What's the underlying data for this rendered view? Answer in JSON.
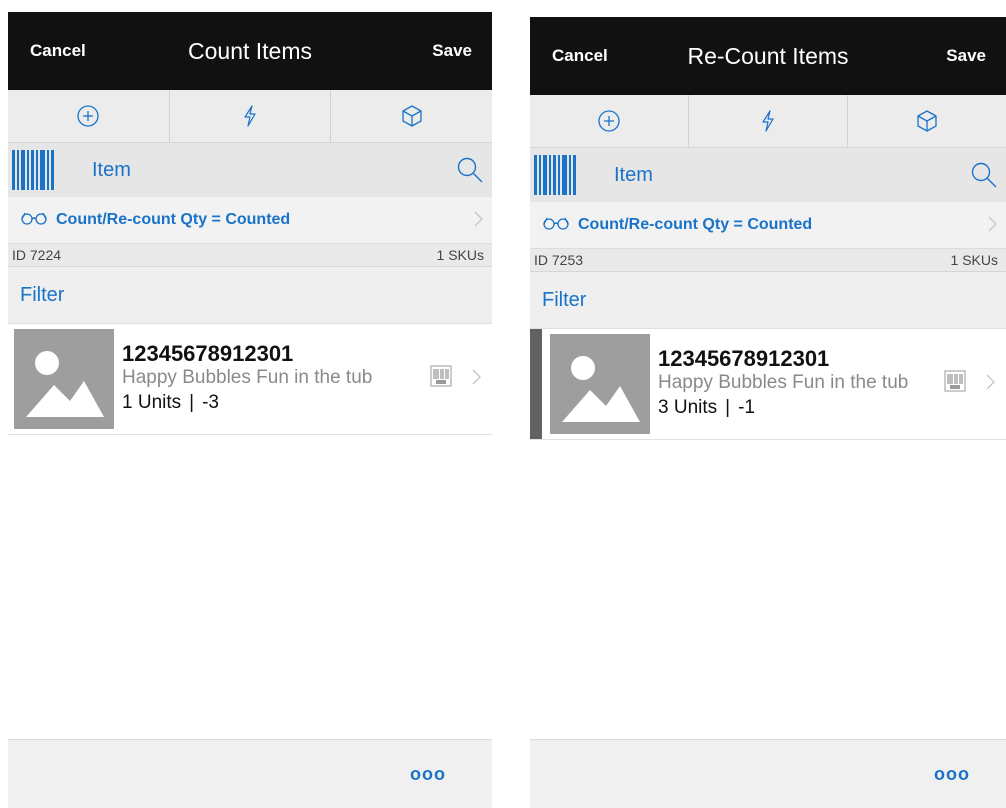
{
  "screens": [
    {
      "header": {
        "cancel_label": "Cancel",
        "title": "Count Items",
        "save_label": "Save"
      },
      "scan": {
        "label": "Item"
      },
      "filter_summary": "Count/Re-count Qty = Counted",
      "info": {
        "id": "ID 7224",
        "skus": "1 SKUs"
      },
      "filter_label": "Filter",
      "item": {
        "sku": "12345678912301",
        "description": "Happy Bubbles Fun in the tub",
        "units": "1 Units",
        "separator": "|",
        "variance": "-3"
      },
      "more_label": "ooo"
    },
    {
      "header": {
        "cancel_label": "Cancel",
        "title": "Re-Count Items",
        "save_label": "Save"
      },
      "scan": {
        "label": "Item"
      },
      "filter_summary": "Count/Re-count Qty = Counted",
      "info": {
        "id": "ID 7253",
        "skus": "1 SKUs"
      },
      "filter_label": "Filter",
      "item": {
        "sku": "12345678912301",
        "description": "Happy Bubbles Fun in the tub",
        "units": "3 Units",
        "separator": "|",
        "variance": "-1"
      },
      "more_label": "ooo"
    }
  ],
  "icons": [
    "plus-circle-icon",
    "lightning-icon",
    "cube-icon",
    "barcode-scan-icon",
    "search-icon",
    "glasses-icon",
    "chevron-right-icon",
    "image-placeholder-icon",
    "small-barcode-icon"
  ],
  "colors": {
    "accent": "#1a73c8",
    "header": "#111111",
    "toolbar": "#ececec",
    "selected_marker": "#616161"
  }
}
